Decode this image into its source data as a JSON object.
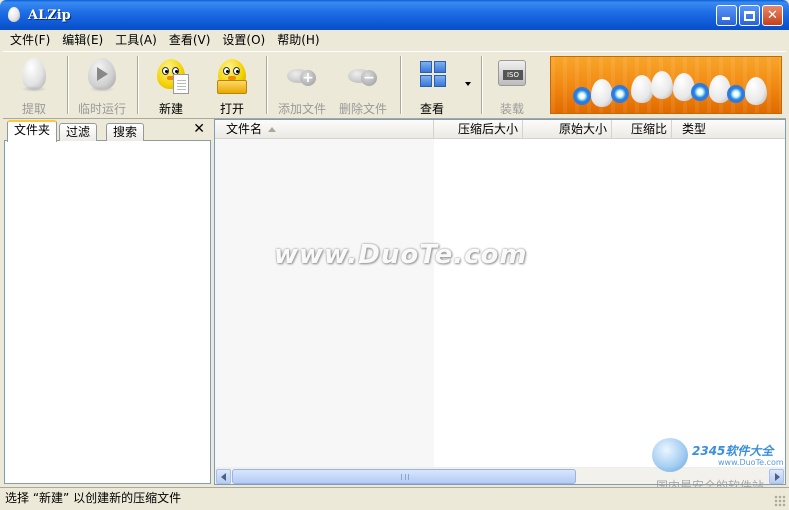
{
  "window": {
    "title": "ALZip"
  },
  "menu": [
    "文件(F)",
    "编辑(E)",
    "工具(A)",
    "查看(V)",
    "设置(O)",
    "帮助(H)"
  ],
  "toolbar": {
    "extract": "提取",
    "temp_run": "临时运行",
    "new": "新建",
    "open": "打开",
    "add_files": "添加文件",
    "delete_files": "删除文件",
    "view": "查看",
    "mount": "装载",
    "iso_label": "ISO"
  },
  "left_panel": {
    "tabs": [
      "文件夹",
      "过滤",
      "搜索"
    ],
    "close": "✕"
  },
  "list": {
    "columns": [
      "文件名",
      "压缩后大小",
      "原始大小",
      "压缩比",
      "类型"
    ]
  },
  "watermark": {
    "text": "www.DuoTe.com",
    "corner_brand": "2345软件大全",
    "corner_site": "www.DuoTe.com",
    "corner_slogan": "国内最安全的软件站"
  },
  "status": {
    "text": "选择 “新建” 以创建新的压缩文件"
  },
  "colors": {
    "title_bar": "#0b55d2",
    "banner": "#f28a12",
    "tab_highlight": "#ffc83c"
  }
}
